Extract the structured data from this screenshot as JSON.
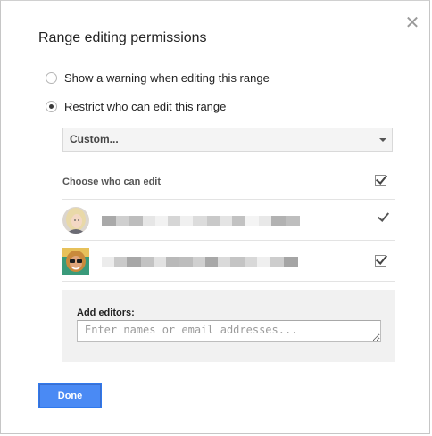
{
  "dialog": {
    "title": "Range editing permissions",
    "close_icon": "close-icon"
  },
  "options": [
    {
      "label": "Show a warning when editing this range",
      "selected": false
    },
    {
      "label": "Restrict who can edit this range",
      "selected": true
    }
  ],
  "select": {
    "value": "Custom..."
  },
  "editors": {
    "header": "Choose who can edit",
    "header_checked": true,
    "rows": [
      {
        "avatar": "avatar-blonde",
        "email_redacted": true,
        "checked": true,
        "locked": true
      },
      {
        "avatar": "avatar-sunglasses",
        "email_redacted": true,
        "checked": true,
        "locked": false
      }
    ]
  },
  "add": {
    "label": "Add editors:",
    "placeholder": "Enter names or email addresses...",
    "value": ""
  },
  "done_label": "Done",
  "colors": {
    "primary": "#4a8af4",
    "panel_bg": "#f1f1f1",
    "select_bg": "#f4f4f4"
  }
}
